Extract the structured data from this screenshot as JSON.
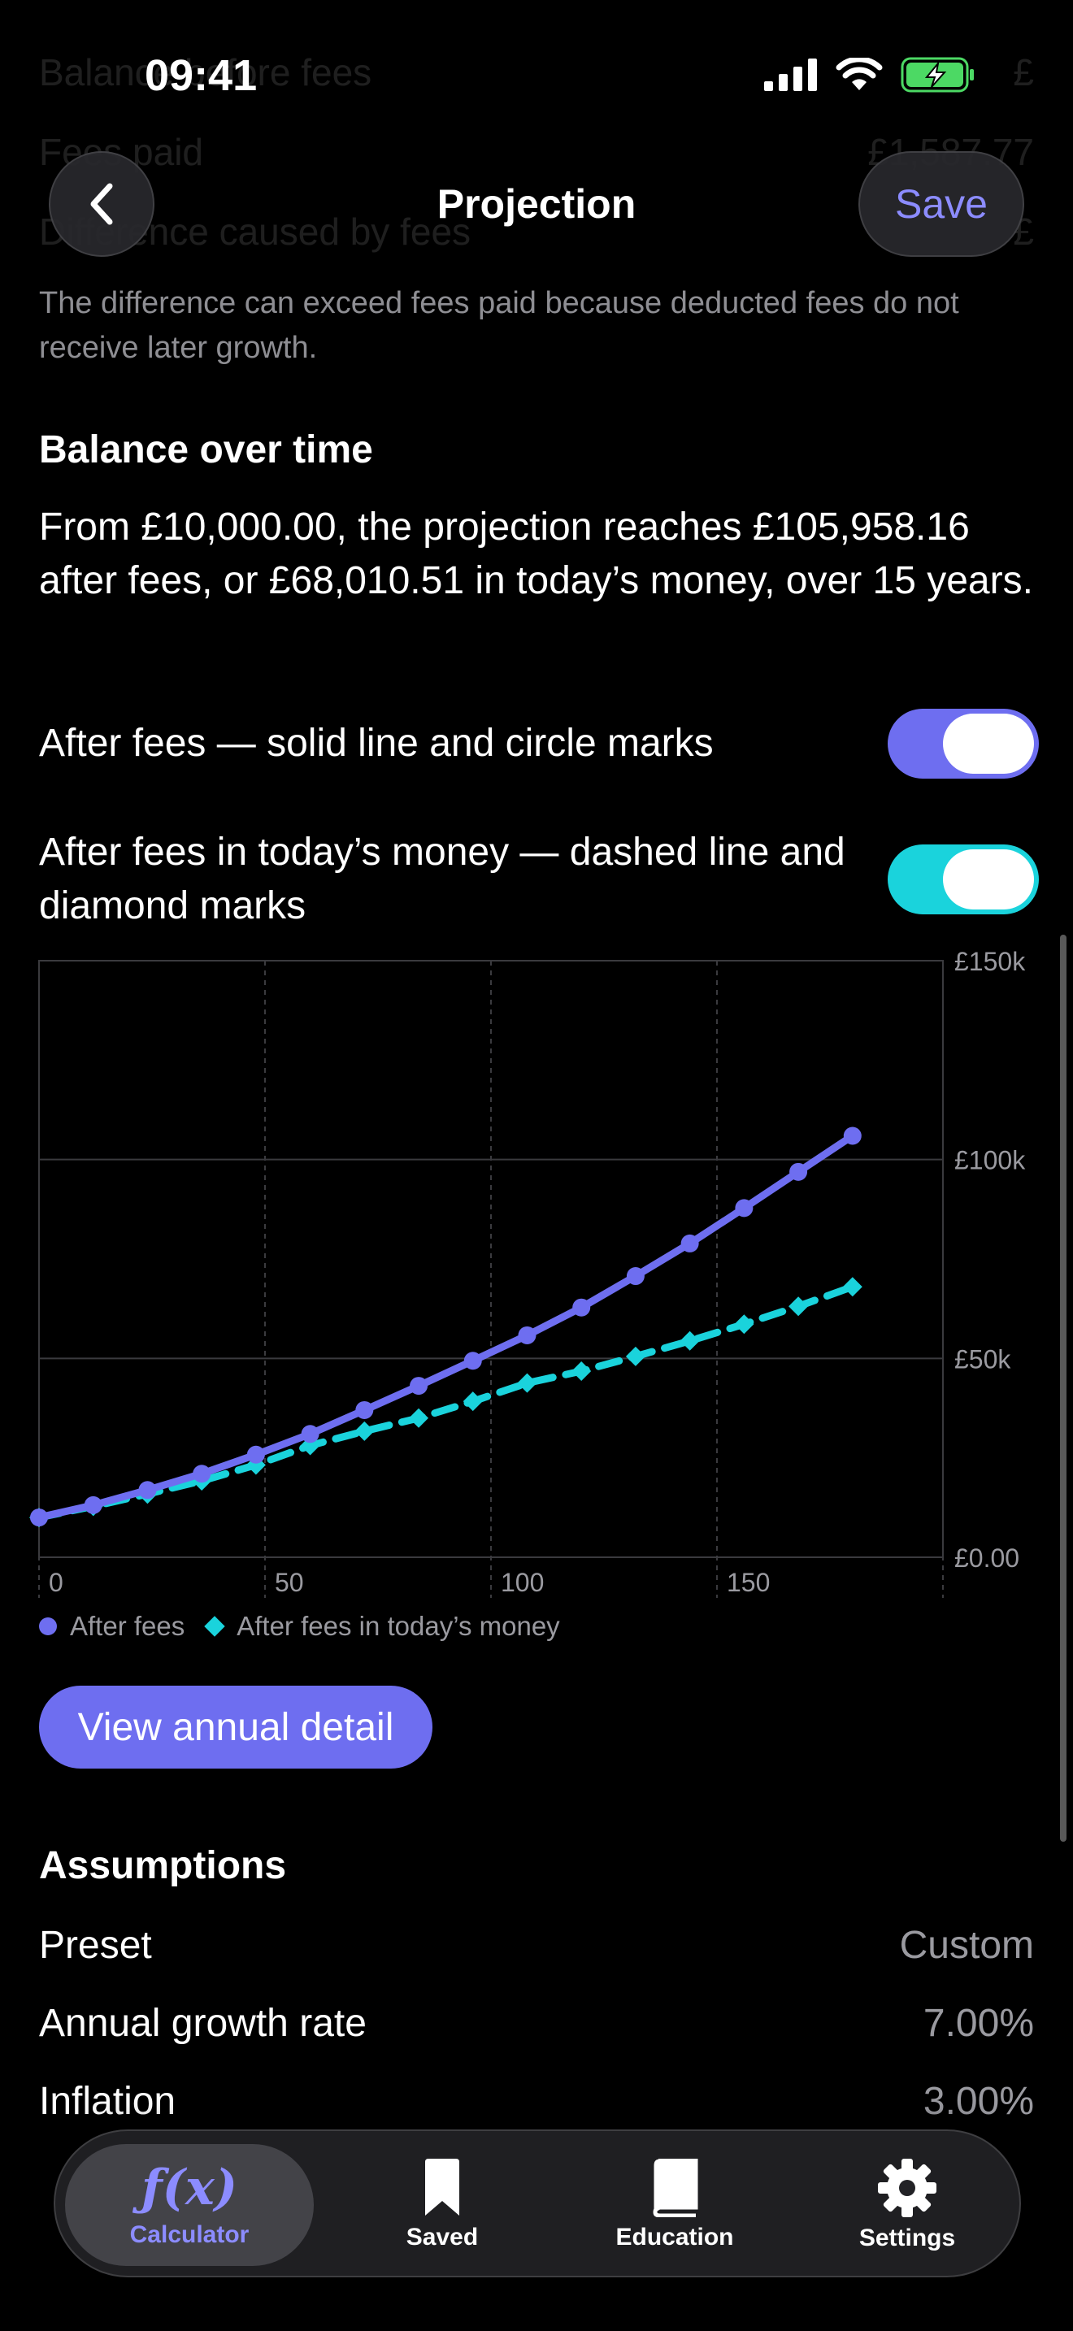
{
  "status_bar": {
    "time": "09:41"
  },
  "ghost_rows": [
    {
      "label": "Balance before fees",
      "value": "£"
    },
    {
      "label": "Fees paid",
      "value": "£1,587.77"
    },
    {
      "label": "Difference caused by fees",
      "value": "£"
    }
  ],
  "header": {
    "title": "Projection",
    "save_label": "Save"
  },
  "fees_note": "The difference can exceed fees paid because deducted fees do not receive later growth.",
  "balance_section": {
    "heading": "Balance over time",
    "summary": "From £10,000.00, the projection reaches £105,958.16 after fees, or £68,010.51 in today’s money, over 15 years."
  },
  "toggles": [
    {
      "label": "After fees — solid line and circle marks",
      "on": true,
      "color": "#6e6ef0"
    },
    {
      "label": "After fees in today’s money — dashed line and diamond marks",
      "on": true,
      "color": "#1ad3dc"
    }
  ],
  "chart_data": {
    "type": "line",
    "x": [
      0,
      12,
      24,
      36,
      48,
      60,
      72,
      84,
      96,
      108,
      120,
      132,
      144,
      156,
      168,
      180
    ],
    "series": [
      {
        "name": "After fees",
        "color": "#6e6ef0",
        "marker": "circle",
        "dash": false,
        "values": [
          10000,
          13100,
          16900,
          21000,
          25800,
          31000,
          37000,
          43100,
          49400,
          55800,
          62800,
          70700,
          78900,
          87800,
          96900,
          105958.16
        ]
      },
      {
        "name": "After fees in today’s money",
        "color": "#1ad3dc",
        "marker": "diamond",
        "dash": true,
        "values": [
          10000,
          12800,
          15900,
          19200,
          23200,
          28100,
          31700,
          35000,
          39200,
          43800,
          46800,
          50500,
          54400,
          58600,
          63100,
          68010.51
        ]
      }
    ],
    "x_ticks": [
      {
        "v": 0,
        "label": "0"
      },
      {
        "v": 50,
        "label": "50"
      },
      {
        "v": 100,
        "label": "100"
      },
      {
        "v": 150,
        "label": "150"
      }
    ],
    "y_ticks": [
      {
        "v": 0,
        "label": "£0.00"
      },
      {
        "v": 50000,
        "label": "£50k"
      },
      {
        "v": 100000,
        "label": "£100k"
      },
      {
        "v": 150000,
        "label": "£150k"
      }
    ],
    "xlim": [
      0,
      200
    ],
    "ylim": [
      0,
      150000
    ],
    "grid": true,
    "legend": "bottom-left"
  },
  "view_detail_label": "View annual detail",
  "assumptions": {
    "heading": "Assumptions",
    "rows": [
      {
        "label": "Preset",
        "value": "Custom"
      },
      {
        "label": "Annual growth rate",
        "value": "7.00%"
      },
      {
        "label": "Inflation",
        "value": "3.00%"
      }
    ]
  },
  "tabs": [
    {
      "label": "Calculator",
      "icon": "function-icon",
      "glyph": "ƒ(x)",
      "active": true
    },
    {
      "label": "Saved",
      "icon": "bookmark-icon",
      "active": false
    },
    {
      "label": "Education",
      "icon": "book-icon",
      "active": false
    },
    {
      "label": "Settings",
      "icon": "gear-icon",
      "active": false
    }
  ]
}
